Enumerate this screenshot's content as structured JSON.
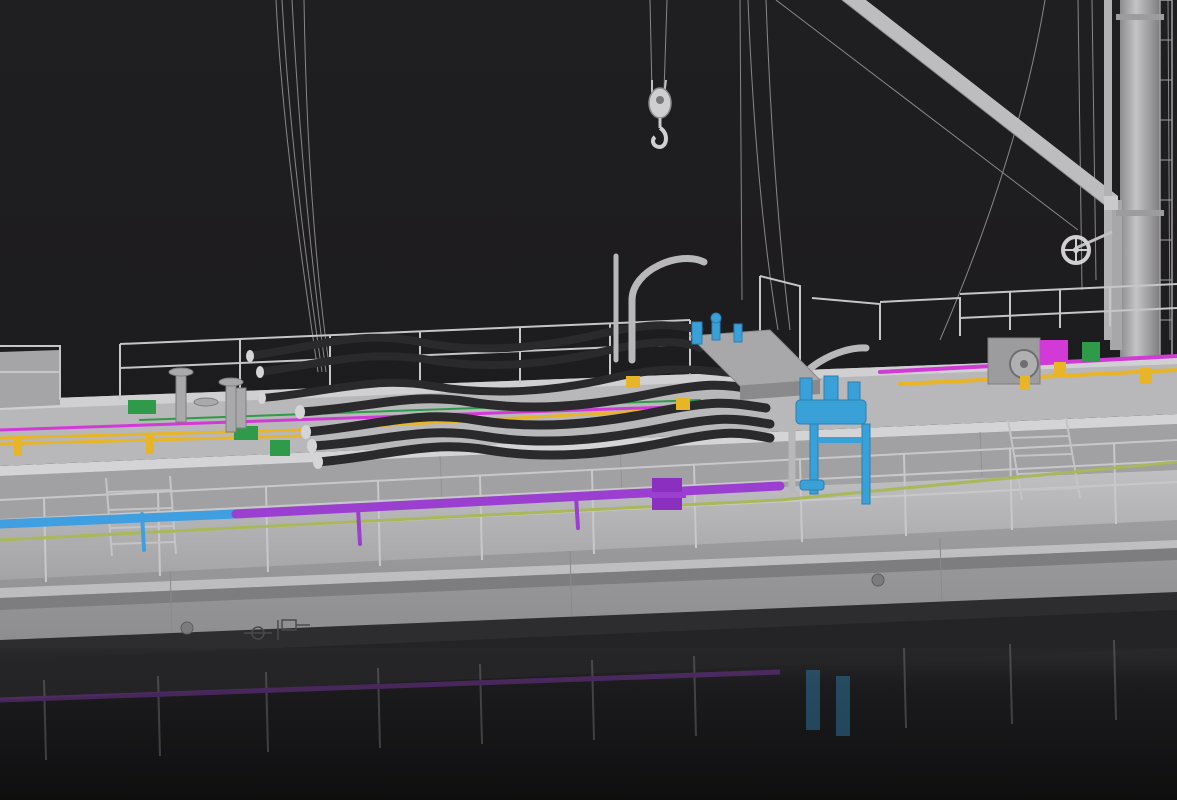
{
  "scene": {
    "icons": [
      "crane-hook-icon",
      "pulley-block-icon",
      "handwheel-icon",
      "porthole-icon",
      "valve-icon",
      "hose-coupling-icon"
    ]
  },
  "colors": {
    "background": "#1c1b1d",
    "water": "#161617",
    "hull": "#9b9b9d",
    "deck": "#b1b1b3",
    "railing": "#c8c8ca",
    "pipe_blue": "#3f9fe0",
    "pipe_purple": "#9b3fd0",
    "pipe_magenta": "#d13ad6",
    "pipe_yellow": "#e8b428",
    "pipe_green": "#2f9a4a",
    "pipe_olive": "#a8b85a",
    "hose": "#2a2a2c",
    "valve_blue": "#3aa0d8"
  }
}
